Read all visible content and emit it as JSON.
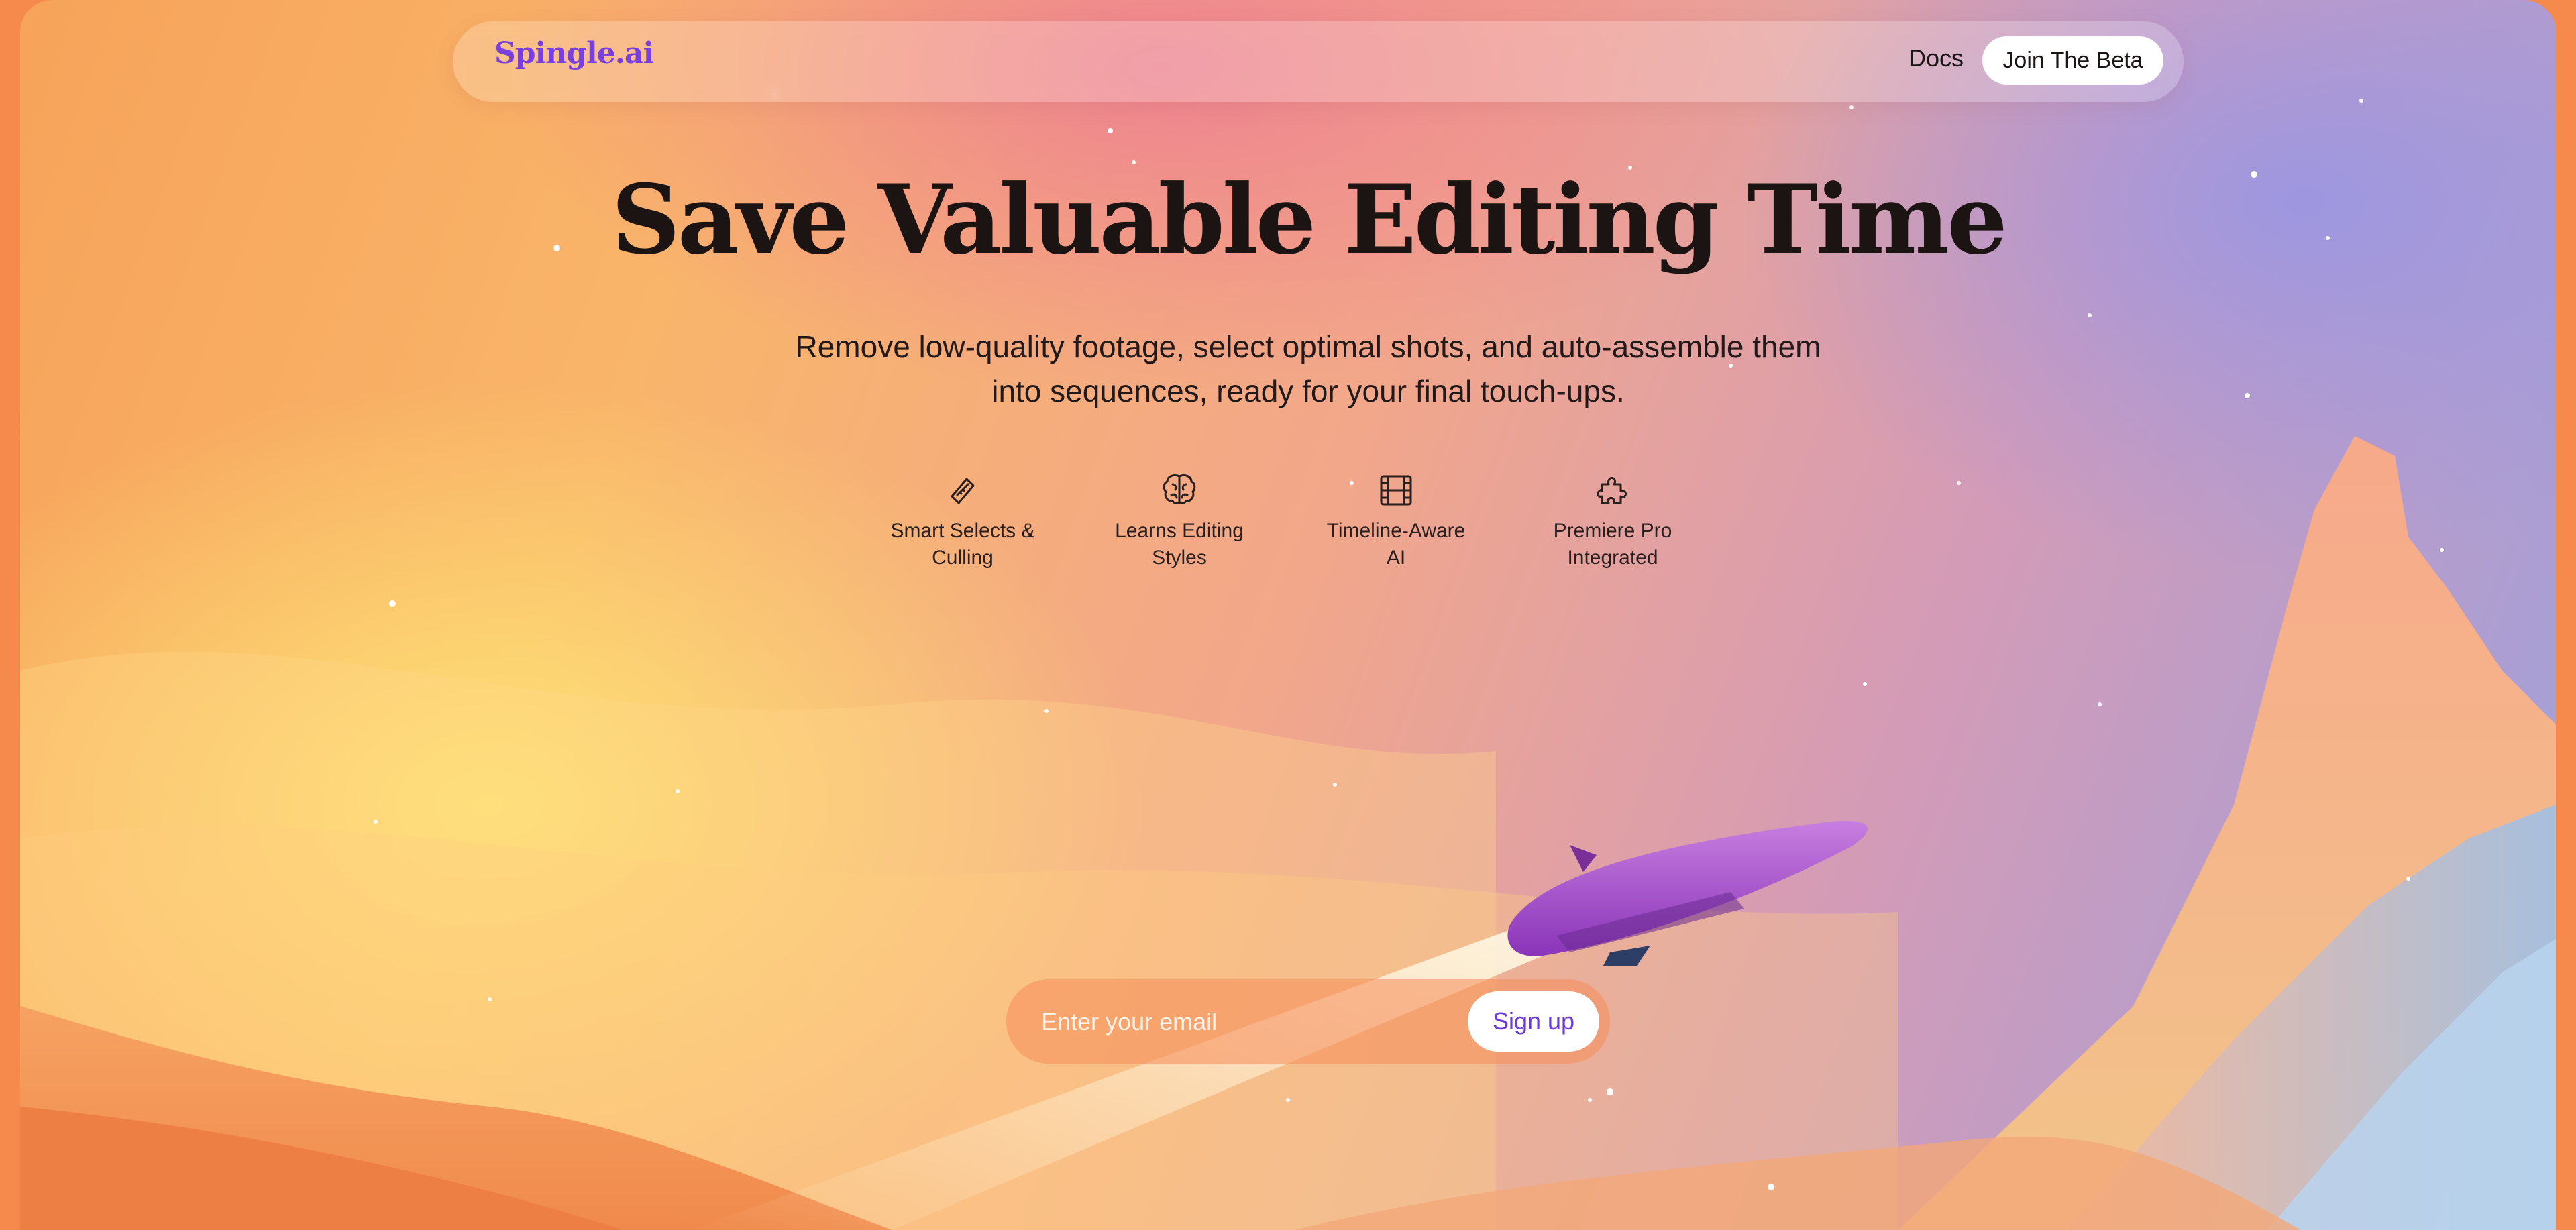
{
  "nav": {
    "logo": "Spingle.ai",
    "docs_label": "Docs",
    "beta_label": "Join The Beta"
  },
  "hero": {
    "title": "Save Valuable Editing Time",
    "subtitle": "Remove low-quality footage, select optimal shots, and auto-assemble them into sequences, ready for your final touch-ups."
  },
  "features": [
    {
      "icon": "razor-blade-icon",
      "label": "Smart Selects &\nCulling"
    },
    {
      "icon": "brain-icon",
      "label": "Learns Editing\nStyles"
    },
    {
      "icon": "film-strip-icon",
      "label": "Timeline-Aware\nAI"
    },
    {
      "icon": "puzzle-piece-icon",
      "label": "Premiere Pro\nIntegrated"
    }
  ],
  "signup": {
    "placeholder": "Enter your email",
    "button_label": "Sign up"
  },
  "colors": {
    "accent": "#7a3fe0",
    "button_text": "#6d3ad8",
    "page_edge": "#f58a4c"
  }
}
